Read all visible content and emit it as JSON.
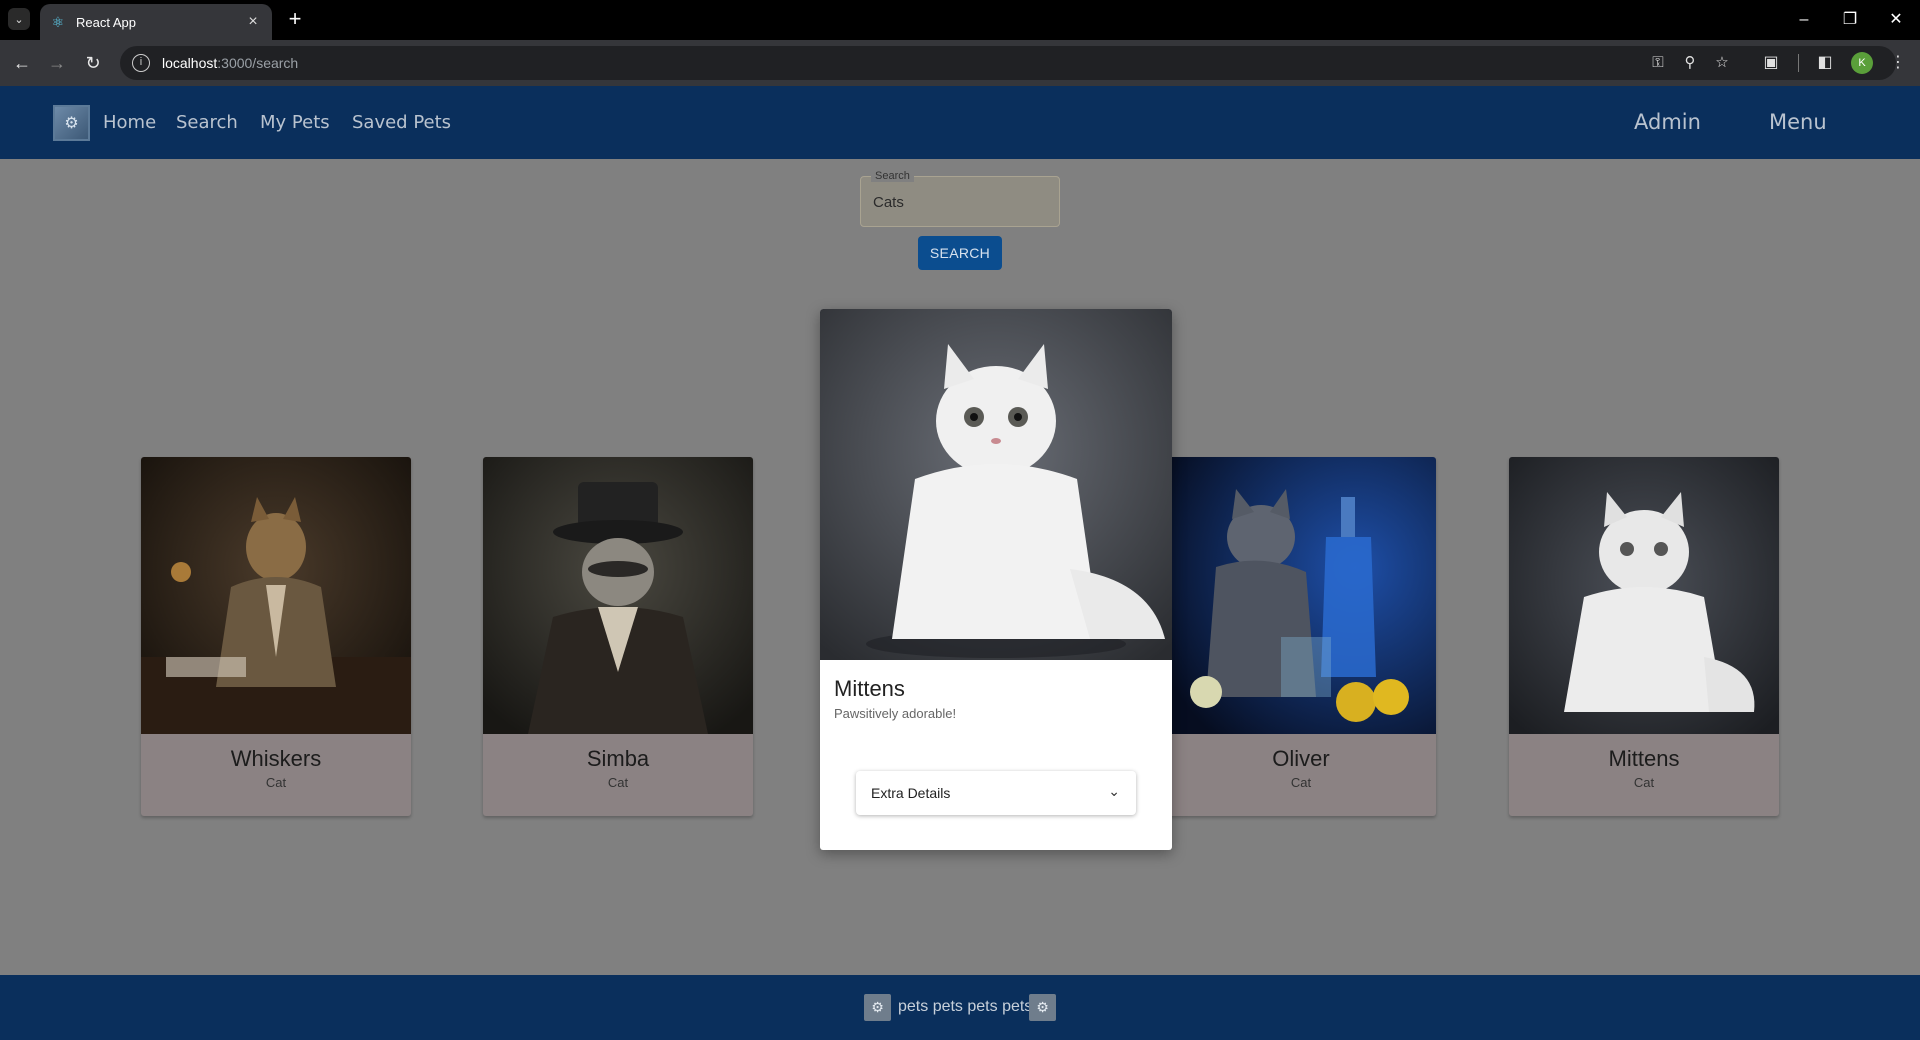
{
  "browser": {
    "tab_title": "React App",
    "url_host": "localhost",
    "url_path": ":3000/search",
    "profile_initial": "K"
  },
  "header": {
    "nav": [
      "Home",
      "Search",
      "My Pets",
      "Saved Pets"
    ],
    "admin_label": "Admin",
    "menu_label": "Menu"
  },
  "search": {
    "label": "Search",
    "value": "Cats",
    "button_label": "SEARCH"
  },
  "cards": [
    {
      "name": "Whiskers",
      "type": "Cat"
    },
    {
      "name": "Simba",
      "type": "Cat"
    },
    {
      "name": "Oliver",
      "type": "Cat"
    },
    {
      "name": "Mittens",
      "type": "Cat"
    }
  ],
  "featured": {
    "name": "Mittens",
    "tagline": "Pawsitively adorable!",
    "details_label": "Extra Details"
  },
  "footer": {
    "text": "pets pets pets pets"
  },
  "colors": {
    "header_bg": "#0a2f5c",
    "page_bg": "#808080",
    "button_bg": "#0b4d8f"
  }
}
